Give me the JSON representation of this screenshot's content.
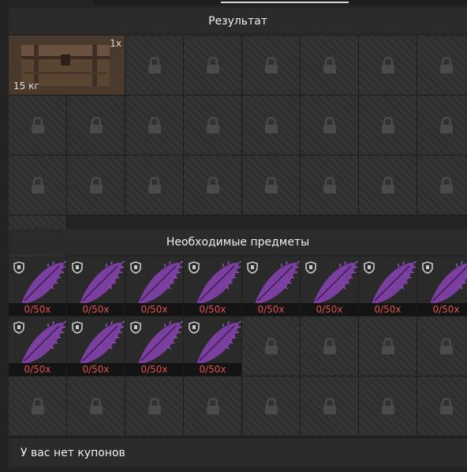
{
  "result": {
    "title": "Результат",
    "item": {
      "name": "chest",
      "quantity": "1x",
      "weight": "15 кг"
    },
    "locked_slots": 23
  },
  "required": {
    "title": "Необходимые предметы",
    "items": [
      {
        "count": "0/50x"
      },
      {
        "count": "0/50x"
      },
      {
        "count": "0/50x"
      },
      {
        "count": "0/50x"
      },
      {
        "count": "0/50x"
      },
      {
        "count": "0/50x"
      },
      {
        "count": "0/50x"
      },
      {
        "count": "0/50x"
      },
      {
        "count": "0/50x"
      },
      {
        "count": "0/50x"
      },
      {
        "count": "0/50x"
      },
      {
        "count": "0/50x"
      }
    ],
    "locked_slots": 12
  },
  "footer": {
    "text": "У вас нет купонов"
  },
  "colors": {
    "count_text": "#e05050",
    "feather": "#7b3fa0"
  },
  "icons": [
    "lock-icon",
    "shield-icon",
    "feather-icon",
    "chest-icon"
  ]
}
